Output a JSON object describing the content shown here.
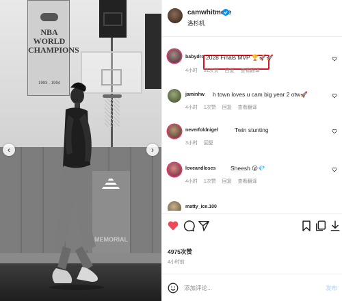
{
  "photo": {
    "banner_text": "NBA WORLD CHAMPIONS",
    "banner_years": "1993 - 1994",
    "pillar_text": "MEMORIAL",
    "prev_icon": "chevron-left-icon",
    "next_icon": "chevron-right-icon"
  },
  "header": {
    "username": "camwhitmore",
    "verified": true,
    "location": "洛杉机"
  },
  "comments": [
    {
      "username": "babydro",
      "text": "2028 Finals MVP 🏆🚀🚀",
      "time": "4小时",
      "likes": "31次赞",
      "reply": "回复",
      "translate": "查看翻译",
      "highlighted": true
    },
    {
      "username": "jaminhw",
      "text": "h town loves u cam big year 2 otw🚀",
      "time": "4小时",
      "likes": "1次赞",
      "reply": "回复",
      "translate": "查看翻译"
    },
    {
      "username": "neverfoldnigel",
      "text": "Twin stunting",
      "time": "3小时",
      "likes": "",
      "reply": "回复",
      "translate": ""
    },
    {
      "username": "loveandloses",
      "text": "Sheesh 😮💎",
      "time": "4小时",
      "likes": "1次赞",
      "reply": "回复",
      "translate": "查看翻译"
    },
    {
      "username": "matty_ice.100",
      "text": "",
      "time": "",
      "likes": "",
      "reply": "",
      "translate": ""
    }
  ],
  "actions": {
    "like_icon": "heart-filled-icon",
    "comment_icon": "comment-bubble-icon",
    "share_icon": "send-icon",
    "save_icon": "bookmark-icon",
    "multi_icon": "copy-icon",
    "collapse_icon": "collapse-icon"
  },
  "stats": {
    "likes": "4975次赞",
    "time": "4小时前"
  },
  "composer": {
    "placeholder": "添加评论...",
    "post_label": "发布"
  },
  "colors": {
    "like_red": "#ed4956",
    "highlight_red": "#d9141c",
    "verified_blue": "#0095f6"
  }
}
